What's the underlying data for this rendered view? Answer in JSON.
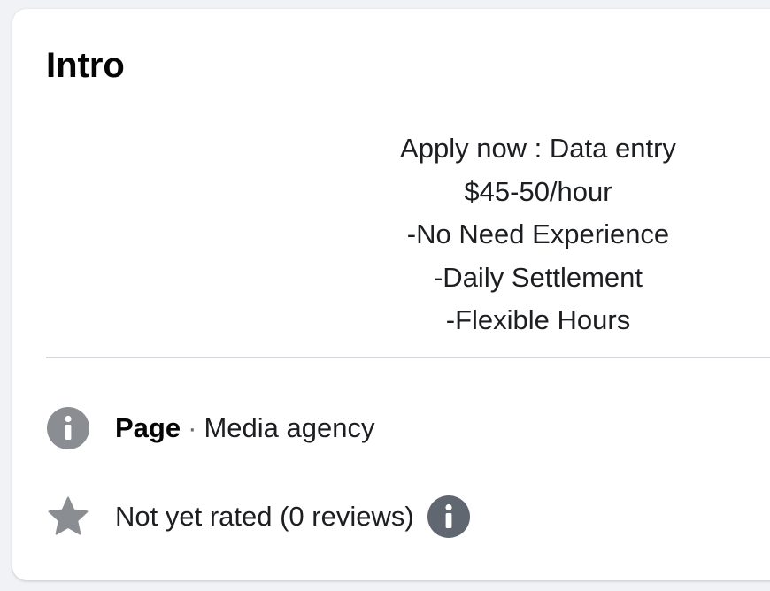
{
  "intro": {
    "title": "Intro",
    "bio_lines": [
      "Apply now : Data entry",
      "$45-50/hour",
      "-No Need Experience",
      "-Daily Settlement",
      "-Flexible Hours"
    ],
    "page_label": "Page",
    "page_separator": "·",
    "page_category": "Media agency",
    "rating_text": "Not yet rated (0 reviews)"
  },
  "colors": {
    "icon_gray": "#8a8d91",
    "icon_dark": "#606770",
    "divider": "#d3d6db"
  },
  "icons": {
    "page_info": "info-circle-icon",
    "rating": "star-icon",
    "rating_info": "info-circle-icon"
  }
}
